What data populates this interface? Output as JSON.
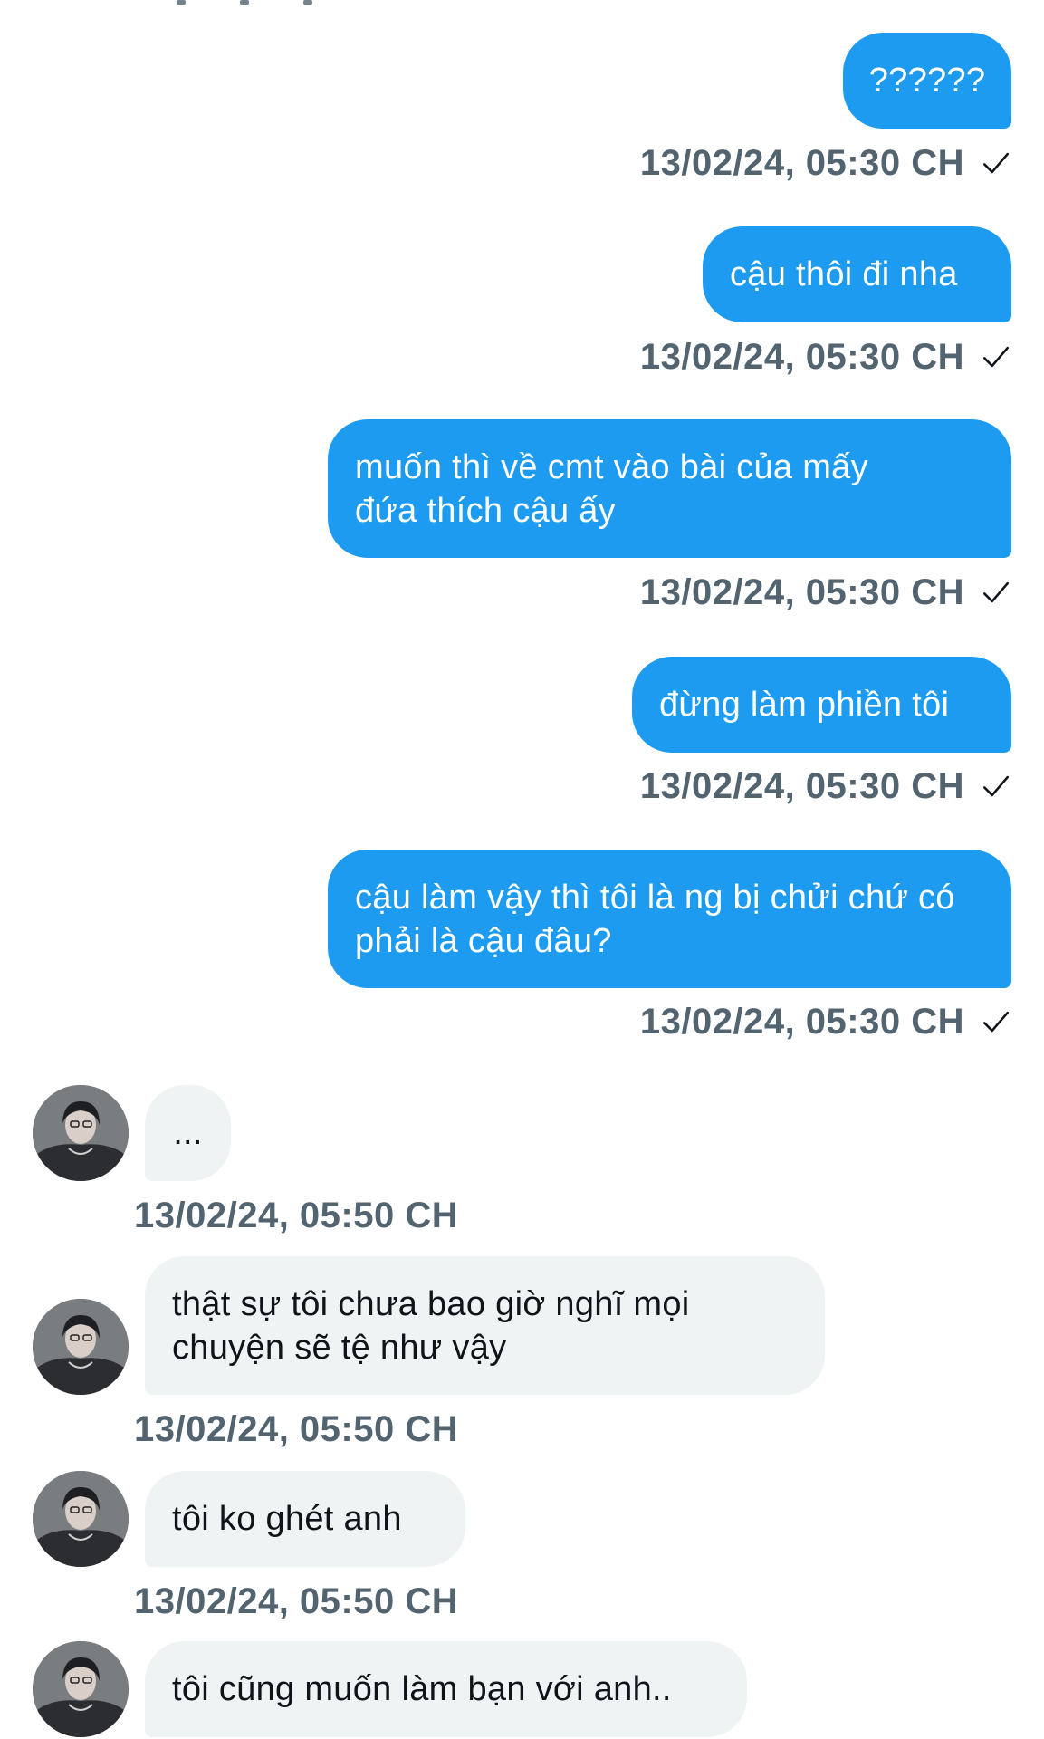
{
  "colors": {
    "outgoing_bubble": "#1d9bf0",
    "incoming_bubble": "#eff3f4",
    "meta_text": "#536471"
  },
  "messages": [
    {
      "direction": "out",
      "text": "??????",
      "time": "13/02/24, 05:30 CH",
      "status_icon": "check-icon"
    },
    {
      "direction": "out",
      "text": "cậu thôi đi nha",
      "time": "13/02/24, 05:30 CH",
      "status_icon": "check-icon"
    },
    {
      "direction": "out",
      "text": "muốn thì về cmt vào bài của mấy đứa thích cậu ấy",
      "time": "13/02/24, 05:30 CH",
      "status_icon": "check-icon"
    },
    {
      "direction": "out",
      "text": "đừng làm phiền tôi",
      "time": "13/02/24, 05:30 CH",
      "status_icon": "check-icon"
    },
    {
      "direction": "out",
      "text": "cậu làm vậy thì tôi là ng bị chửi chứ có phải là cậu đâu?",
      "time": "13/02/24, 05:30 CH",
      "status_icon": "check-icon"
    },
    {
      "direction": "in",
      "text": "...",
      "time": "13/02/24, 05:50 CH",
      "avatar": "user-avatar"
    },
    {
      "direction": "in",
      "text": "thật sự tôi chưa bao giờ nghĩ mọi chuyện sẽ tệ như vậy",
      "time": "13/02/24, 05:50 CH",
      "avatar": "user-avatar"
    },
    {
      "direction": "in",
      "text": "tôi ko ghét anh",
      "time": "13/02/24, 05:50 CH",
      "avatar": "user-avatar"
    },
    {
      "direction": "in",
      "text": "tôi cũng muốn làm bạn với anh..",
      "time": "",
      "avatar": "user-avatar"
    }
  ]
}
